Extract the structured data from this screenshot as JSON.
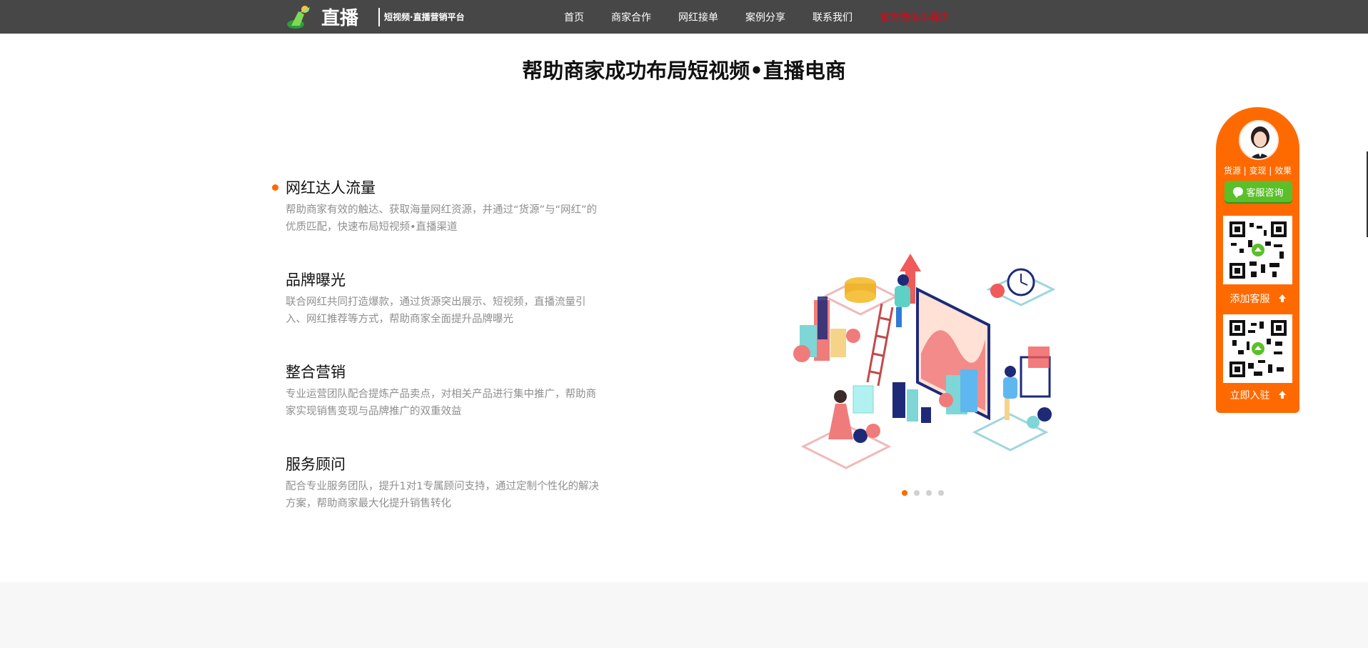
{
  "header": {
    "logo_text": "直播",
    "logo_subtitle": "短视频·直播营销平台",
    "nav": [
      {
        "label": "首页"
      },
      {
        "label": "商家合作"
      },
      {
        "label": "网红接单"
      },
      {
        "label": "案例分享"
      },
      {
        "label": "联系我们"
      },
      {
        "label": "官方微信小程序"
      }
    ],
    "highlight_color": "#e60012"
  },
  "section": {
    "title": "帮助商家成功布局短视频•直播电商"
  },
  "features": [
    {
      "title": "网红达人流量",
      "desc": "帮助商家有效的触达、获取海量网红资源，并通过“货源”与“网红”的优质匹配，快速布局短视频•直播渠道",
      "active": true
    },
    {
      "title": "品牌曝光",
      "desc": "联合网红共同打造爆款，通过货源突出展示、短视频，直播流量引入、网红推荐等方式，帮助商家全面提升品牌曝光",
      "active": false
    },
    {
      "title": "整合营销",
      "desc": "专业运营团队配合提炼产品卖点，对相关产品进行集中推广，帮助商家实现销售变现与品牌推广的双重效益",
      "active": false
    },
    {
      "title": "服务顾问",
      "desc": "配合专业服务团队，提升1对1专属顾问支持，通过定制个性化的解决方案，帮助商家最大化提升销售转化",
      "active": false
    }
  ],
  "carousel": {
    "slides": 4,
    "active_index": 0,
    "accent_color": "#ff6a00"
  },
  "side_panel": {
    "tags": "货源 | 变现 | 效果",
    "consult_label": "客服咨询",
    "add_service_label": "添加客服",
    "join_label": "立即入驻",
    "panel_color": "#ff6a00",
    "button_color": "#5bbf2a"
  }
}
